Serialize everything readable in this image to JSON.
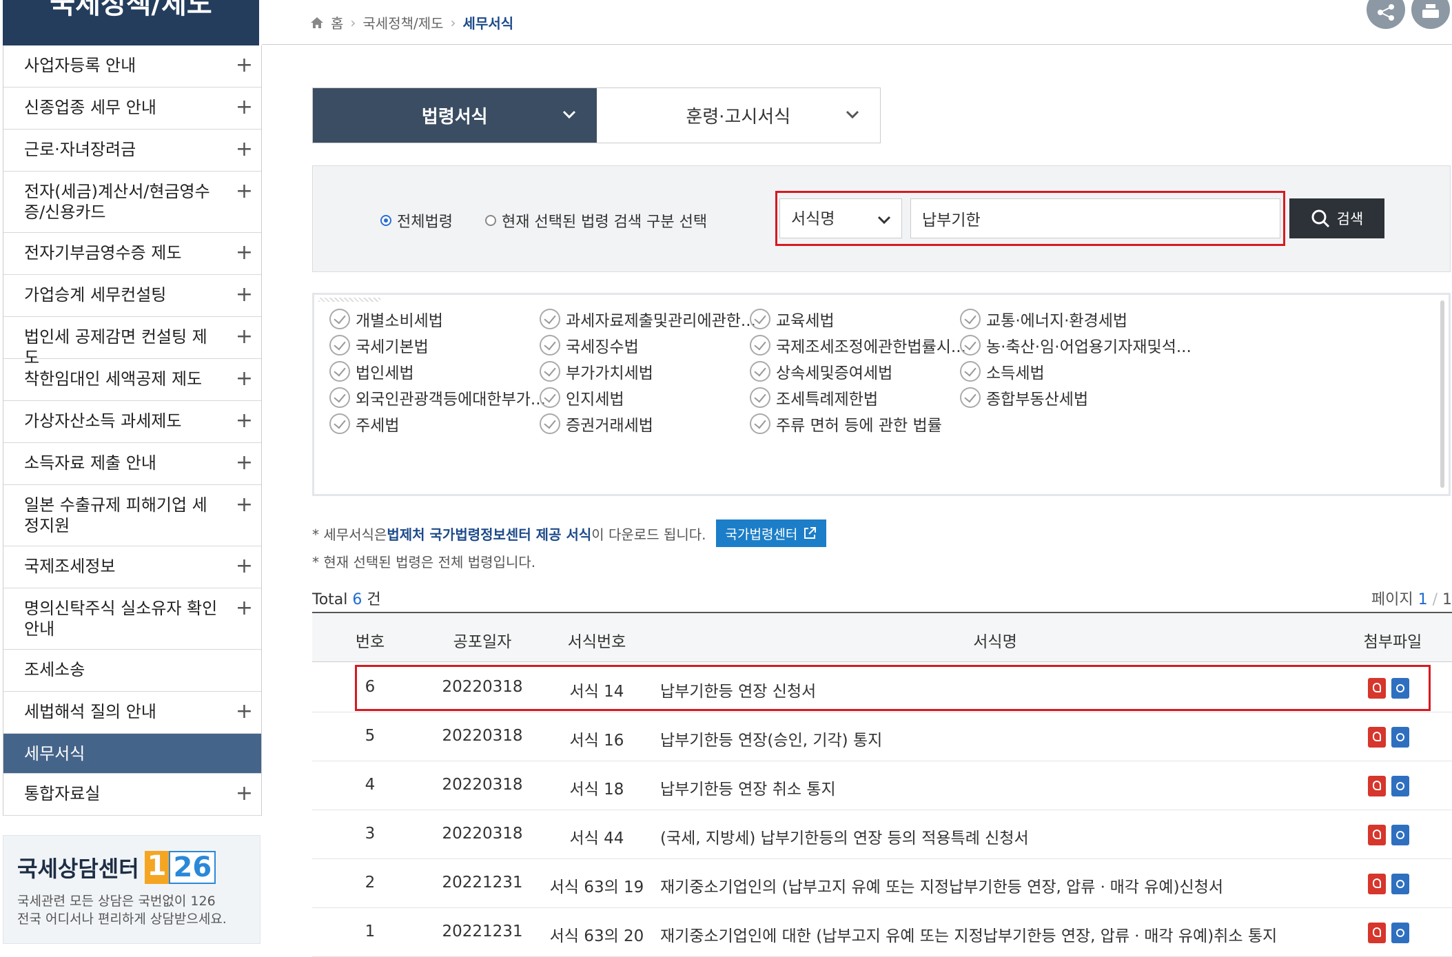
{
  "sidebar": {
    "title": "국세정책/제도",
    "items": [
      {
        "label": "사업자등록 안내",
        "active": false
      },
      {
        "label": "신종업종 세무 안내",
        "active": false
      },
      {
        "label": "근로·자녀장려금",
        "active": false
      },
      {
        "label": "전자(세금)계산서/현금영수증/신용카드",
        "active": false
      },
      {
        "label": "전자기부금영수증 제도",
        "active": false
      },
      {
        "label": "가업승계 세무컨설팅",
        "active": false
      },
      {
        "label": "법인세 공제감면 컨설팅 제도",
        "active": false
      },
      {
        "label": "착한임대인 세액공제 제도",
        "active": false
      },
      {
        "label": "가상자산소득 과세제도",
        "active": false
      },
      {
        "label": "소득자료 제출 안내",
        "active": false
      },
      {
        "label": "일본 수출규제 피해기업 세정지원",
        "active": false
      },
      {
        "label": "국제조세정보",
        "active": false
      },
      {
        "label": "명의신탁주식 실소유자 확인안내",
        "active": false
      },
      {
        "label": "조세소송",
        "active": false,
        "noplus": true
      },
      {
        "label": "세법해석 질의 안내",
        "active": false
      },
      {
        "label": "세무서식",
        "active": true
      },
      {
        "label": "통합자료실",
        "active": false
      }
    ],
    "counsel": {
      "title": "국세상담센터",
      "number_1": "1",
      "number_26": "26",
      "desc_1": "국세관련 모든 상담은 국번없이 126",
      "desc_2": "전국 어디서나 편리하게 상담받으세요."
    }
  },
  "breadcrumb": {
    "home": "홈",
    "level1": "국세정책/제도",
    "current": "세무서식"
  },
  "tabs": [
    {
      "label": "법령서식",
      "active": true
    },
    {
      "label": "훈령·고시서식",
      "active": false
    }
  ],
  "search": {
    "radio_all": "전체법령",
    "radio_selected": "현재 선택된 법령 검색 구분 선택",
    "select_value": "서식명",
    "input_value": "납부기한",
    "button_label": "검색"
  },
  "laws": [
    [
      "개별소비세법",
      "과세자료제출및관리에관한...",
      "교육세법",
      "교통·에너지·환경세법"
    ],
    [
      "국세기본법",
      "국세징수법",
      "국제조세조정에관한법률시...",
      "농·축산·임·어업용기자재및석..."
    ],
    [
      "법인세법",
      "부가가치세법",
      "상속세및증여세법",
      "소득세법"
    ],
    [
      "외국인관광객등에대한부가...",
      "인지세법",
      "조세특례제한법",
      "종합부동산세법"
    ],
    [
      "주세법",
      "증권거래세법",
      "주류 면허 등에 관한 법률",
      ""
    ]
  ],
  "notes": {
    "line1_a": "* 세무서식은 ",
    "line1_b": "법제처 국가법령정보센터 제공 서식",
    "line1_c": "이 다운로드 됩니다.",
    "law_center_button": "국가법령센터",
    "line2": "* 현재 선택된 법령은 전체 법령입니다."
  },
  "results": {
    "total_label": "Total",
    "total_count": "6",
    "total_unit": "건",
    "page_label": "페이지",
    "page_current": "1",
    "page_sep": "/",
    "page_total": "1",
    "headers": [
      "번호",
      "공포일자",
      "서식번호",
      "서식명",
      "첨부파일"
    ],
    "rows": [
      {
        "no": "6",
        "date": "20220318",
        "form_no": "서식 14",
        "name": "납부기한등 연장 신청서"
      },
      {
        "no": "5",
        "date": "20220318",
        "form_no": "서식 16",
        "name": "납부기한등 연장(승인, 기각) 통지"
      },
      {
        "no": "4",
        "date": "20220318",
        "form_no": "서식 18",
        "name": "납부기한등 연장 취소 통지"
      },
      {
        "no": "3",
        "date": "20220318",
        "form_no": "서식 44",
        "name": "(국세, 지방세) 납부기한등의 연장 등의 적용특례 신청서"
      },
      {
        "no": "2",
        "date": "20221231",
        "form_no": "서식 63의 19",
        "name": "재기중소기업인의 (납부고지 유예 또는 지정납부기한등 연장, 압류ㆍ매각 유예)신청서"
      },
      {
        "no": "1",
        "date": "20221231",
        "form_no": "서식 63의 20",
        "name": "재기중소기업인에 대한 (납부고지 유예 또는 지정납부기한등 연장, 압류ㆍ매각 유예)취소 통지"
      }
    ]
  },
  "colors": {
    "sidebar_title_bg": "#243d5c",
    "active_item_bg": "#45648a",
    "tab_active_bg": "#3b4d62",
    "highlight_red": "#d71920",
    "link_blue": "#1c4a8a",
    "button_blue": "#1c7ec8"
  }
}
